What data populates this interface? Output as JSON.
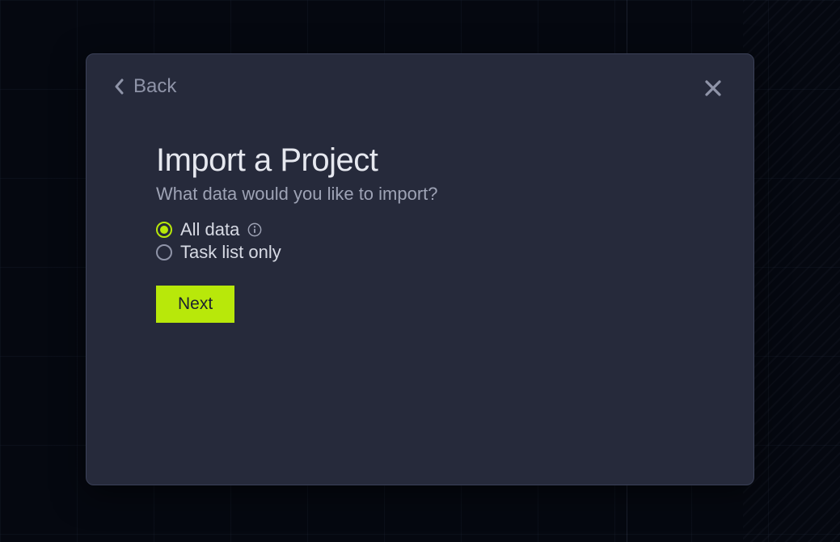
{
  "modal": {
    "back_label": "Back",
    "title": "Import a Project",
    "subtitle": "What data would you like to import?",
    "options": [
      {
        "label": "All data",
        "has_info": true,
        "selected": true
      },
      {
        "label": "Task list only",
        "has_info": false,
        "selected": false
      }
    ],
    "next_label": "Next"
  },
  "colors": {
    "accent": "#b8e80a",
    "modal_bg": "#262a3b",
    "page_bg": "#050810"
  }
}
